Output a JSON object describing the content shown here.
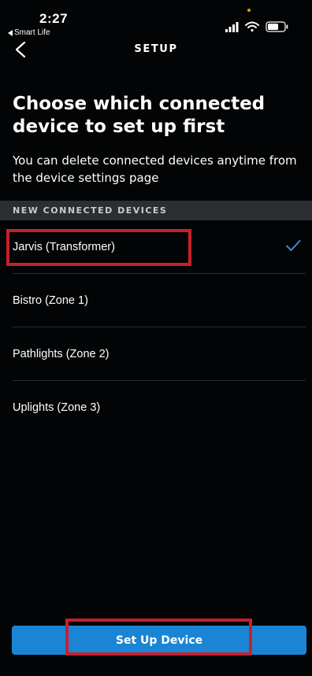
{
  "status_bar": {
    "time": "2:27",
    "back_app_label": "Smart Life",
    "icons": [
      "cellular-signal-icon",
      "wifi-icon",
      "battery-icon"
    ]
  },
  "nav": {
    "title": "SETUP",
    "back_icon": "chevron-left-icon"
  },
  "page": {
    "heading": "Choose which connected device to set up first",
    "subtext": "You can delete connected devices anytime from the device settings page"
  },
  "section": {
    "header": "NEW CONNECTED DEVICES"
  },
  "devices": [
    {
      "label": "Jarvis (Transformer)",
      "selected": true
    },
    {
      "label": "Bistro (Zone 1)",
      "selected": false
    },
    {
      "label": "Pathlights (Zone 2)",
      "selected": false
    },
    {
      "label": "Uplights (Zone 3)",
      "selected": false
    }
  ],
  "footer": {
    "button_label": "Set Up Device"
  },
  "colors": {
    "background": "#020405",
    "accent": "#1a85d4",
    "checkmark": "#3a8fd6",
    "section_header_bg": "#2b2f33",
    "annotation_red": "#c8202a",
    "status_dot": "#ff9500"
  }
}
